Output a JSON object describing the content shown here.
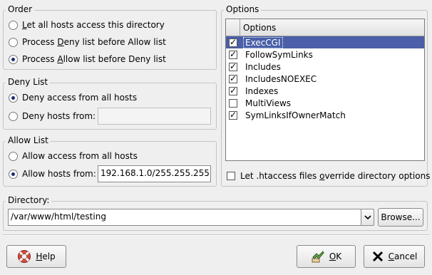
{
  "order": {
    "title": "Order",
    "options": [
      {
        "label_pre": "",
        "mnemonic": "L",
        "label_post": "et all hosts access this directory",
        "selected": false
      },
      {
        "label_pre": "Process ",
        "mnemonic": "D",
        "label_post": "eny list before Allow list",
        "selected": false
      },
      {
        "label_pre": "Process ",
        "mnemonic": "A",
        "label_post": "llow list before Deny list",
        "selected": true
      }
    ]
  },
  "deny_list": {
    "title": "Deny List",
    "opt_all": "Deny access from all hosts",
    "opt_from": "Deny hosts from:",
    "from_value": ""
  },
  "allow_list": {
    "title": "Allow List",
    "opt_all": "Allow access from all hosts",
    "opt_from": "Allow hosts from:",
    "from_value": "192.168.1.0/255.255.255.0"
  },
  "options": {
    "title": "Options",
    "column_header": "Options",
    "items": [
      {
        "label": "ExecCGI",
        "checked": true,
        "selected": true
      },
      {
        "label": "FollowSymLinks",
        "checked": true,
        "selected": false
      },
      {
        "label": "Includes",
        "checked": true,
        "selected": false
      },
      {
        "label": "IncludesNOEXEC",
        "checked": true,
        "selected": false
      },
      {
        "label": "Indexes",
        "checked": true,
        "selected": false
      },
      {
        "label": "MultiViews",
        "checked": false,
        "selected": false
      },
      {
        "label": "SymLinksIfOwnerMatch",
        "checked": true,
        "selected": false
      }
    ],
    "htaccess_pre": "Let .htaccess files ",
    "htaccess_mnemonic": "o",
    "htaccess_post": "verride directory options",
    "htaccess_checked": false
  },
  "directory": {
    "title": "Directory:",
    "value": "/var/www/html/testing",
    "browse_label": "Browse..."
  },
  "buttons": {
    "help_mnemonic": "H",
    "help_rest": "elp",
    "ok_mnemonic": "O",
    "ok_rest": "K",
    "cancel_mnemonic": "C",
    "cancel_rest": "ancel"
  },
  "colors": {
    "selection": "#4a5fa8",
    "window_bg": "#efefef"
  }
}
